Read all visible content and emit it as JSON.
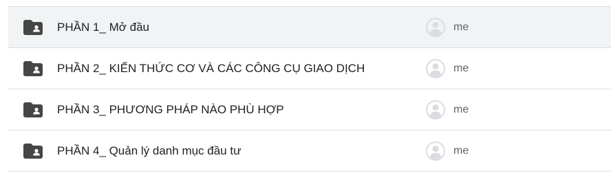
{
  "colors": {
    "selected_row_bg": "#f1f3f4",
    "divider": "#dadce0",
    "folder_icon": "#444746",
    "avatar": "#dadce0",
    "text_primary": "#202124",
    "text_secondary": "#5f6368"
  },
  "rows": [
    {
      "name": "PHẦN 1_ Mở đầu",
      "owner": "me",
      "icon": "shared-folder-icon",
      "selected": true
    },
    {
      "name": "PHẦN 2_ KIẾN THỨC CƠ VÀ CÁC CÔNG CỤ GIAO DỊCH",
      "owner": "me",
      "icon": "shared-folder-icon",
      "selected": false
    },
    {
      "name": "PHẦN 3_ PHƯƠNG PHÁP NÀO PHÙ HỢP",
      "owner": "me",
      "icon": "shared-folder-icon",
      "selected": false
    },
    {
      "name": "PHẦN 4_ Quản lý danh mục đầu tư",
      "owner": "me",
      "icon": "shared-folder-icon",
      "selected": false
    }
  ]
}
